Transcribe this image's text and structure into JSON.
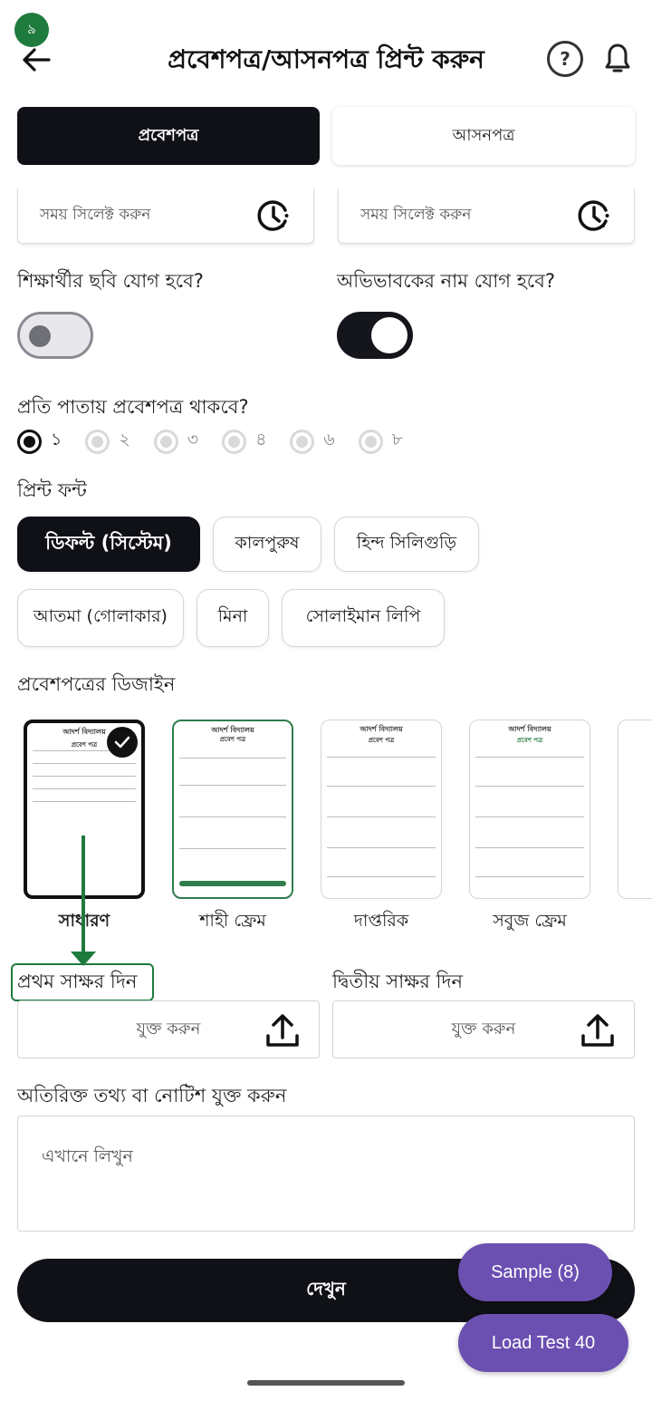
{
  "step_badge": "৯",
  "header": {
    "title": "প্রবেশপত্র/আসনপত্র প্রিন্ট করুন",
    "help": "?"
  },
  "tabs": [
    {
      "label": "প্রবেশপত্র",
      "active": true
    },
    {
      "label": "আসনপত্র",
      "active": false
    }
  ],
  "time_fields": [
    {
      "placeholder": "সময় সিলেক্ট করুন"
    },
    {
      "placeholder": "সময় সিলেক্ট করুন"
    }
  ],
  "toggles": [
    {
      "label": "শিক্ষার্থীর ছবি যোগ হবে?",
      "on": false
    },
    {
      "label": "অভিভাবকের নাম যোগ হবে?",
      "on": true
    }
  ],
  "per_page": {
    "label": "প্রতি পাতায় প্রবেশপত্র থাকবে?",
    "options": [
      "১",
      "২",
      "৩",
      "৪",
      "৬",
      "৮"
    ],
    "selected": "১"
  },
  "print_font": {
    "label": "প্রিন্ট ফন্ট",
    "options": [
      "ডিফল্ট (সিস্টেম)",
      "কালপুরুষ",
      "হিন্দ সিলিগুড়ি",
      "আতমা (গোলাকার)",
      "মিনা",
      "সোলাইমান লিপি"
    ],
    "selected": "ডিফল্ট (সিস্টেম)"
  },
  "design": {
    "label": "প্রবেশপত্রের ডিজাইন",
    "cards": [
      {
        "label": "সাধারণ",
        "selected": true,
        "mini_title": "আদর্শ বিদ্যালয়",
        "mini_sub": "প্রবেশ পত্র"
      },
      {
        "label": "শাহী ফ্রেম",
        "selected": false,
        "mini_title": "আদর্শ বিদ্যালয়",
        "mini_sub": "প্রবেশ পত্র"
      },
      {
        "label": "দাপ্তরিক",
        "selected": false,
        "mini_title": "আদর্শ বিদ্যালয়",
        "mini_sub": "প্রবেশ পত্র"
      },
      {
        "label": "সবুজ ফ্রেম",
        "selected": false,
        "mini_title": "আদর্শ বিদ্যালয়",
        "mini_sub": "প্রবেশ পত্র"
      }
    ]
  },
  "signatures": [
    {
      "label": "প্রথম সাক্ষর দিন",
      "button": "যুক্ত করুন"
    },
    {
      "label": "দ্বিতীয় সাক্ষর দিন",
      "button": "যুক্ত করুন"
    }
  ],
  "notice": {
    "label": "অতিরিক্ত তথ্য বা নোটিশ যুক্ত করুন",
    "placeholder": "এখানে লিখুন"
  },
  "view_button": "দেখুন",
  "fabs": {
    "sample": "Sample (8)",
    "load_test": "Load Test 40"
  },
  "colors": {
    "primary_dark": "#0f1116",
    "accent_green": "#1f7a3e",
    "fab_purple": "#6b4fb1"
  }
}
